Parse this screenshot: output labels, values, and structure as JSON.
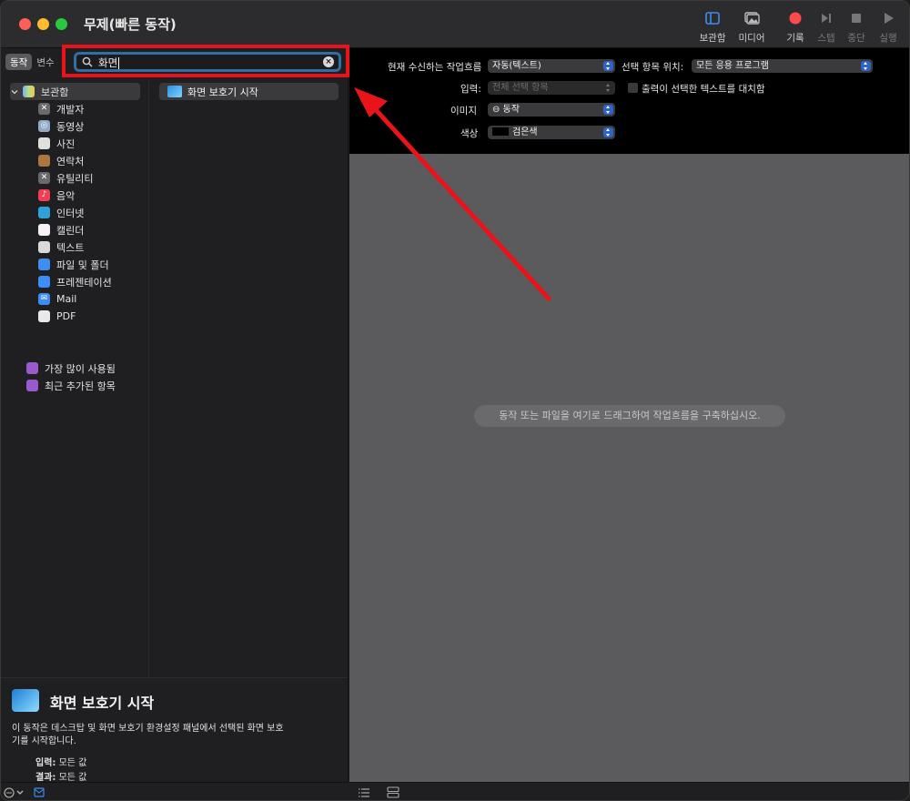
{
  "window": {
    "title": "무제(빠른 동작)"
  },
  "toolbar": {
    "library": "보관함",
    "media": "미디어",
    "record": "기록",
    "step": "스텝",
    "stop": "중단",
    "run": "실행"
  },
  "tabs": {
    "actions": "동작",
    "variables": "변수"
  },
  "search": {
    "value": "화면"
  },
  "library": {
    "root": "보관함",
    "items": [
      {
        "label": "개발자"
      },
      {
        "label": "동영상"
      },
      {
        "label": "사진"
      },
      {
        "label": "연락처"
      },
      {
        "label": "유틸리티"
      },
      {
        "label": "음악"
      },
      {
        "label": "인터넷"
      },
      {
        "label": "캘린더"
      },
      {
        "label": "텍스트"
      },
      {
        "label": "파일 및 폴더"
      },
      {
        "label": "프레젠테이션"
      },
      {
        "label": "Mail"
      },
      {
        "label": "PDF"
      }
    ],
    "most_used": "가장 많이 사용됨",
    "recently_added": "최근 추가된 항목"
  },
  "results": [
    {
      "label": "화면 보호기 시작"
    }
  ],
  "description": {
    "title": "화면 보호기 시작",
    "text": "이 동작은 데스크탑 및 화면 보호기 환경설정 패널에서 선택된 화면 보호기를 시작합니다.",
    "input_key": "입력:",
    "input_val": "모든 값",
    "result_key": "결과:",
    "result_val": "모든 값"
  },
  "config": {
    "receives_label": "현재 수신하는 작업흐름",
    "receives_value": "자동(텍스트)",
    "in_label": "선택 항목 위치:",
    "in_value": "모든 응용 프로그램",
    "input_label": "입력:",
    "input_value": "전체 선택 항목",
    "replace_label": "출력이 선택한 텍스트를 대치함",
    "image_label": "이미지",
    "image_value": "⊖ 동작",
    "color_label": "색상",
    "color_value": "검은색"
  },
  "workflow": {
    "hint": "동작 또는 파일을 여기로 드래그하여 작업흐름을 구축하십시오."
  },
  "colors": {
    "accent": "#2e63c8",
    "annotation": "#e8141a",
    "record": "#fe4a4a"
  }
}
